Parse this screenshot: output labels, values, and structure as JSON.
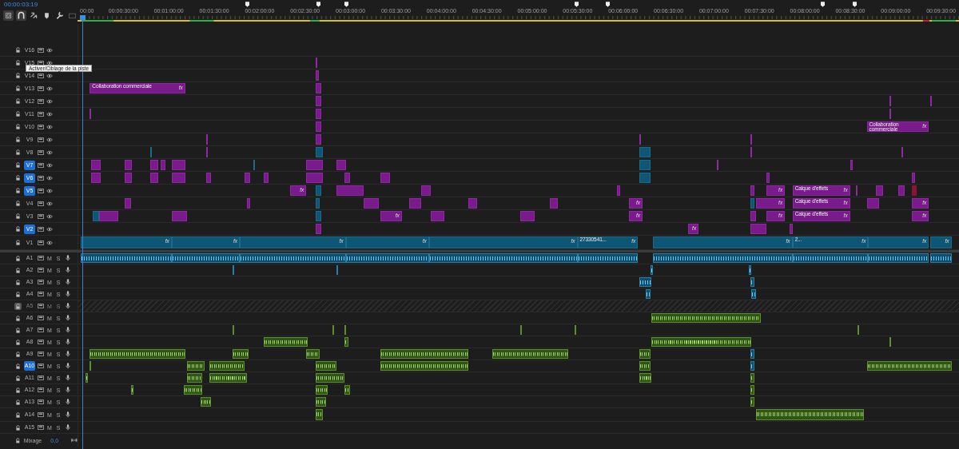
{
  "timecode": "00:00:03:19",
  "tooltip": "Activer/Ciblage de la piste",
  "ruler": {
    "labels": [
      "00:00",
      "00:00:30:00",
      "00:01:00:00",
      "00:01:30:00",
      "00:02:00:00",
      "00:02:30:00",
      "00:03:00:00",
      "00:03:30:00",
      "00:04:00:00",
      "00:04:30:00",
      "00:05:00:00",
      "00:05:30:00",
      "00:06:00:00",
      "00:06:30:00",
      "00:07:00:00",
      "00:07:30:00",
      "00:08:00:00",
      "00:08:30:00",
      "00:09:00:00",
      "00:09:30:00"
    ]
  },
  "tracks": [
    {
      "kind": "video",
      "name": "V16",
      "targeted": false,
      "locked": false
    },
    {
      "kind": "video",
      "name": "V15",
      "targeted": false,
      "locked": false,
      "clips": [
        {
          "kind": "adjust"
        }
      ]
    },
    {
      "kind": "video",
      "name": "V14",
      "targeted": false,
      "locked": false,
      "clips": [
        {
          "kind": "adjust"
        }
      ]
    },
    {
      "kind": "video",
      "name": "V13",
      "targeted": false,
      "locked": false,
      "clips": [
        {
          "kind": "adjust",
          "label": "Collaboration commerciale",
          "badge": "fx"
        },
        {
          "kind": "adjust"
        }
      ]
    },
    {
      "kind": "video",
      "name": "V12",
      "targeted": false,
      "locked": false,
      "clips": [
        {
          "kind": "adjust"
        },
        {
          "kind": "adjust"
        },
        {
          "kind": "adjust"
        }
      ]
    },
    {
      "kind": "video",
      "name": "V11",
      "targeted": false,
      "locked": false,
      "clips": [
        {
          "kind": "adjust"
        },
        {
          "kind": "adjust"
        },
        {
          "kind": "adjust"
        }
      ]
    },
    {
      "kind": "video",
      "name": "V10",
      "targeted": false,
      "locked": false,
      "clips": [
        {
          "kind": "adjust"
        },
        {
          "kind": "adjust",
          "label": "Collaboration commerciale",
          "badge": "fx"
        }
      ]
    },
    {
      "kind": "video",
      "name": "V9",
      "targeted": false,
      "locked": false,
      "clips": [
        {
          "kind": "adjust"
        },
        {
          "kind": "adjust"
        },
        {
          "kind": "adjust"
        },
        {
          "kind": "adjust"
        }
      ]
    },
    {
      "kind": "video",
      "name": "V8",
      "targeted": false,
      "locked": false,
      "clips": [
        {
          "kind": "video"
        },
        {
          "kind": "adjust"
        },
        {
          "kind": "video"
        },
        {
          "kind": "video"
        },
        {
          "kind": "adjust"
        },
        {
          "kind": "adjust"
        }
      ]
    },
    {
      "kind": "video",
      "name": "V7",
      "targeted": true,
      "locked": false,
      "clips": [
        {
          "kind": "adjust"
        },
        {
          "kind": "adjust"
        },
        {
          "kind": "adjust"
        },
        {
          "kind": "adjust"
        },
        {
          "kind": "adjust"
        },
        {
          "kind": "video"
        },
        {
          "kind": "adjust"
        },
        {
          "kind": "adjust"
        },
        {
          "kind": "video"
        },
        {
          "kind": "adjust"
        },
        {
          "kind": "adjust"
        }
      ]
    },
    {
      "kind": "video",
      "name": "V6",
      "targeted": true,
      "locked": false,
      "clips": [
        {
          "kind": "adjust"
        },
        {
          "kind": "adjust"
        },
        {
          "kind": "adjust"
        },
        {
          "kind": "adjust"
        },
        {
          "kind": "adjust"
        },
        {
          "kind": "adjust"
        },
        {
          "kind": "adjust"
        },
        {
          "kind": "adjust"
        },
        {
          "kind": "adjust"
        },
        {
          "kind": "adjust"
        },
        {
          "kind": "video"
        },
        {
          "kind": "adjust"
        },
        {
          "kind": "adjust"
        }
      ]
    },
    {
      "kind": "video",
      "name": "V5",
      "targeted": true,
      "locked": false,
      "clips": [
        {
          "kind": "adjust",
          "badge": "fx"
        },
        {
          "kind": "video"
        },
        {
          "kind": "adjust"
        },
        {
          "kind": "adjust"
        },
        {
          "kind": "adjust"
        },
        {
          "kind": "adjust"
        },
        {
          "kind": "adjust",
          "badge": "fx"
        },
        {
          "kind": "adjust",
          "label": "Calque d'effets",
          "badge": "fx"
        },
        {
          "kind": "adjust"
        },
        {
          "kind": "adjust"
        },
        {
          "kind": "adjust"
        },
        {
          "kind": "nest"
        }
      ]
    },
    {
      "kind": "video",
      "name": "V4",
      "targeted": false,
      "locked": false,
      "clips": [
        {
          "kind": "adjust"
        },
        {
          "kind": "adjust"
        },
        {
          "kind": "video"
        },
        {
          "kind": "adjust"
        },
        {
          "kind": "adjust"
        },
        {
          "kind": "adjust"
        },
        {
          "kind": "adjust"
        },
        {
          "kind": "adjust",
          "badge": "fx"
        },
        {
          "kind": "video"
        },
        {
          "kind": "adjust",
          "badge": "fx"
        },
        {
          "kind": "adjust",
          "label": "Calque d'effets",
          "badge": "fx"
        },
        {
          "kind": "adjust"
        },
        {
          "kind": "adjust",
          "badge": "fx"
        }
      ]
    },
    {
      "kind": "video",
      "name": "V3",
      "targeted": false,
      "locked": false,
      "clips": [
        {
          "kind": "video"
        },
        {
          "kind": "adjust"
        },
        {
          "kind": "adjust"
        },
        {
          "kind": "video"
        },
        {
          "kind": "adjust",
          "badge": "fx"
        },
        {
          "kind": "adjust"
        },
        {
          "kind": "adjust"
        },
        {
          "kind": "adjust",
          "badge": "fx"
        },
        {
          "kind": "adjust"
        },
        {
          "kind": "adjust",
          "badge": "fx"
        },
        {
          "kind": "adjust",
          "label": "Calque d'effets",
          "badge": "fx"
        },
        {
          "kind": "adjust",
          "badge": "fx"
        }
      ]
    },
    {
      "kind": "video",
      "name": "V2",
      "targeted": true,
      "locked": false,
      "clips": [
        {
          "kind": "adjust"
        },
        {
          "kind": "adjust",
          "badge": "fx"
        },
        {
          "kind": "adjust"
        },
        {
          "kind": "adjust"
        }
      ]
    },
    {
      "kind": "video",
      "name": "V1",
      "targeted": false,
      "locked": false,
      "clips": [
        {
          "kind": "video",
          "badge": "fx"
        },
        {
          "kind": "video",
          "badge": "fx"
        },
        {
          "kind": "video",
          "badge": "fx"
        },
        {
          "kind": "video",
          "badge": "fx"
        },
        {
          "kind": "video",
          "badge": "fx"
        },
        {
          "kind": "video",
          "label": "27330541...",
          "badge": "fx"
        },
        {
          "kind": "video",
          "badge": "fx"
        },
        {
          "kind": "video",
          "label": "2...",
          "badge": "fx"
        },
        {
          "kind": "video",
          "badge": "fx"
        },
        {
          "kind": "video",
          "badge": "fx"
        }
      ]
    },
    {
      "kind": "audio",
      "name": "A1",
      "targeted": false,
      "locked": false,
      "mute": "M",
      "solo": "S",
      "clips": [
        {
          "kind": "linked"
        },
        {
          "kind": "linked"
        },
        {
          "kind": "linked"
        },
        {
          "kind": "linked"
        },
        {
          "kind": "linked"
        },
        {
          "kind": "linked"
        },
        {
          "kind": "linked"
        },
        {
          "kind": "linked"
        },
        {
          "kind": "linked"
        },
        {
          "kind": "linked"
        }
      ]
    },
    {
      "kind": "audio",
      "name": "A2",
      "targeted": false,
      "locked": false,
      "mute": "M",
      "solo": "S",
      "clips": [
        {
          "kind": "linked"
        },
        {
          "kind": "linked"
        },
        {
          "kind": "linked"
        },
        {
          "kind": "linked"
        }
      ]
    },
    {
      "kind": "audio",
      "name": "A3",
      "targeted": false,
      "locked": false,
      "mute": "M",
      "solo": "S",
      "clips": [
        {
          "kind": "linked"
        },
        {
          "kind": "linked"
        }
      ]
    },
    {
      "kind": "audio",
      "name": "A4",
      "targeted": false,
      "locked": false,
      "mute": "M",
      "solo": "S",
      "clips": [
        {
          "kind": "linked"
        },
        {
          "kind": "linked"
        }
      ]
    },
    {
      "kind": "audio",
      "name": "A5",
      "targeted": false,
      "locked": true,
      "mute": "M",
      "solo": "S"
    },
    {
      "kind": "audio",
      "name": "A6",
      "targeted": false,
      "locked": false,
      "mute": "M",
      "solo": "S",
      "clips": [
        {
          "kind": "audio"
        }
      ]
    },
    {
      "kind": "audio",
      "name": "A7",
      "targeted": false,
      "locked": false,
      "mute": "M",
      "solo": "S",
      "clips": [
        {
          "kind": "audio"
        },
        {
          "kind": "audio"
        },
        {
          "kind": "audio"
        },
        {
          "kind": "audio"
        },
        {
          "kind": "audio"
        },
        {
          "kind": "audio"
        }
      ]
    },
    {
      "kind": "audio",
      "name": "A8",
      "targeted": false,
      "locked": false,
      "mute": "M",
      "solo": "S",
      "clips": [
        {
          "kind": "audio"
        },
        {
          "kind": "audio"
        },
        {
          "kind": "audio"
        },
        {
          "kind": "audio"
        }
      ]
    },
    {
      "kind": "audio",
      "name": "A9",
      "targeted": false,
      "locked": false,
      "mute": "M",
      "solo": "S",
      "clips": [
        {
          "kind": "audio"
        },
        {
          "kind": "audio"
        },
        {
          "kind": "audio"
        },
        {
          "kind": "audio"
        },
        {
          "kind": "audio"
        },
        {
          "kind": "audio"
        },
        {
          "kind": "linked"
        }
      ]
    },
    {
      "kind": "audio",
      "name": "A10",
      "targeted": true,
      "locked": false,
      "mute": "M",
      "solo": "S",
      "clips": [
        {
          "kind": "audio"
        },
        {
          "kind": "audio"
        },
        {
          "kind": "audio"
        },
        {
          "kind": "audio"
        },
        {
          "kind": "audio"
        },
        {
          "kind": "audio"
        },
        {
          "kind": "linked"
        },
        {
          "kind": "audio"
        }
      ]
    },
    {
      "kind": "audio",
      "name": "A11",
      "targeted": false,
      "locked": false,
      "mute": "M",
      "solo": "S",
      "clips": [
        {
          "kind": "audio"
        },
        {
          "kind": "audio"
        },
        {
          "kind": "audio"
        },
        {
          "kind": "audio"
        },
        {
          "kind": "audio"
        },
        {
          "kind": "audio"
        }
      ]
    },
    {
      "kind": "audio",
      "name": "A12",
      "targeted": false,
      "locked": false,
      "mute": "M",
      "solo": "S",
      "clips": [
        {
          "kind": "audio"
        },
        {
          "kind": "audio"
        },
        {
          "kind": "audio"
        },
        {
          "kind": "audio"
        },
        {
          "kind": "audio"
        }
      ]
    },
    {
      "kind": "audio",
      "name": "A13",
      "targeted": false,
      "locked": false,
      "mute": "M",
      "solo": "S",
      "clips": [
        {
          "kind": "audio"
        },
        {
          "kind": "audio"
        },
        {
          "kind": "audio"
        }
      ]
    },
    {
      "kind": "audio",
      "name": "A14",
      "targeted": false,
      "locked": false,
      "mute": "M",
      "solo": "S",
      "clips": [
        {
          "kind": "audio"
        },
        {
          "kind": "audio"
        }
      ]
    },
    {
      "kind": "audio",
      "name": "A15",
      "targeted": false,
      "locked": false,
      "mute": "M",
      "solo": "S"
    }
  ],
  "mix": {
    "name": "Mixage",
    "value": "0,0"
  }
}
